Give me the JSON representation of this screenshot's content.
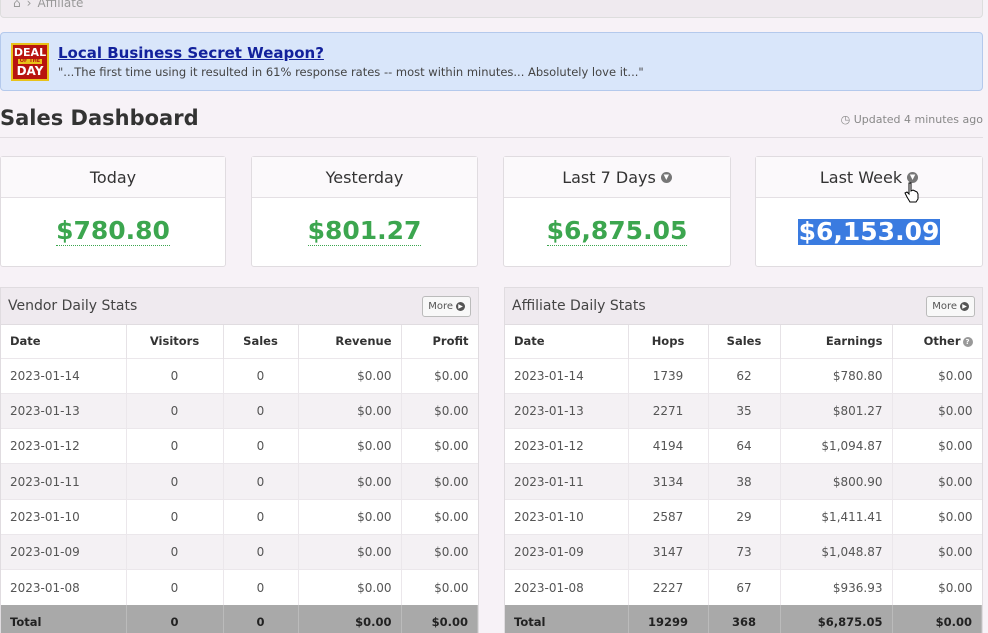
{
  "breadcrumb": {
    "home_icon": "home-icon",
    "separator": "›",
    "current": "Affiliate"
  },
  "promo": {
    "logo": {
      "line1": "DEAL",
      "line2": "OF THE",
      "line3": "DAY"
    },
    "title": "Local Business Secret Weapon?",
    "quote": "\"...The first time using it resulted in 61% response rates -- most within minutes... Absolutely love it...\""
  },
  "dashboard": {
    "title": "Sales Dashboard",
    "updated": "Updated 4 minutes ago"
  },
  "cards": [
    {
      "label": "Today",
      "value": "$780.80"
    },
    {
      "label": "Yesterday",
      "value": "$801.27"
    },
    {
      "label": "Last 7 Days",
      "value": "$6,875.05"
    },
    {
      "label": "Last Week",
      "value": "$6,153.09"
    }
  ],
  "vendor": {
    "title": "Vendor Daily Stats",
    "more": "More",
    "columns": [
      "Date",
      "Visitors",
      "Sales",
      "Revenue",
      "Profit"
    ],
    "rows": [
      [
        "2023-01-14",
        "0",
        "0",
        "$0.00",
        "$0.00"
      ],
      [
        "2023-01-13",
        "0",
        "0",
        "$0.00",
        "$0.00"
      ],
      [
        "2023-01-12",
        "0",
        "0",
        "$0.00",
        "$0.00"
      ],
      [
        "2023-01-11",
        "0",
        "0",
        "$0.00",
        "$0.00"
      ],
      [
        "2023-01-10",
        "0",
        "0",
        "$0.00",
        "$0.00"
      ],
      [
        "2023-01-09",
        "0",
        "0",
        "$0.00",
        "$0.00"
      ],
      [
        "2023-01-08",
        "0",
        "0",
        "$0.00",
        "$0.00"
      ]
    ],
    "total": [
      "Total",
      "0",
      "0",
      "$0.00",
      "$0.00"
    ]
  },
  "affiliate": {
    "title": "Affiliate Daily Stats",
    "more": "More",
    "columns": [
      "Date",
      "Hops",
      "Sales",
      "Earnings",
      "Other"
    ],
    "rows": [
      [
        "2023-01-14",
        "1739",
        "62",
        "$780.80",
        "$0.00"
      ],
      [
        "2023-01-13",
        "2271",
        "35",
        "$801.27",
        "$0.00"
      ],
      [
        "2023-01-12",
        "4194",
        "64",
        "$1,094.87",
        "$0.00"
      ],
      [
        "2023-01-11",
        "3134",
        "38",
        "$800.90",
        "$0.00"
      ],
      [
        "2023-01-10",
        "2587",
        "29",
        "$1,411.41",
        "$0.00"
      ],
      [
        "2023-01-09",
        "3147",
        "73",
        "$1,048.87",
        "$0.00"
      ],
      [
        "2023-01-08",
        "2227",
        "67",
        "$936.93",
        "$0.00"
      ]
    ],
    "total": [
      "Total",
      "19299",
      "368",
      "$6,875.05",
      "$0.00"
    ]
  },
  "colors": {
    "accent_green": "#3ca64f",
    "promo_bg": "#d9e6fa",
    "selection": "#3a7be0"
  }
}
